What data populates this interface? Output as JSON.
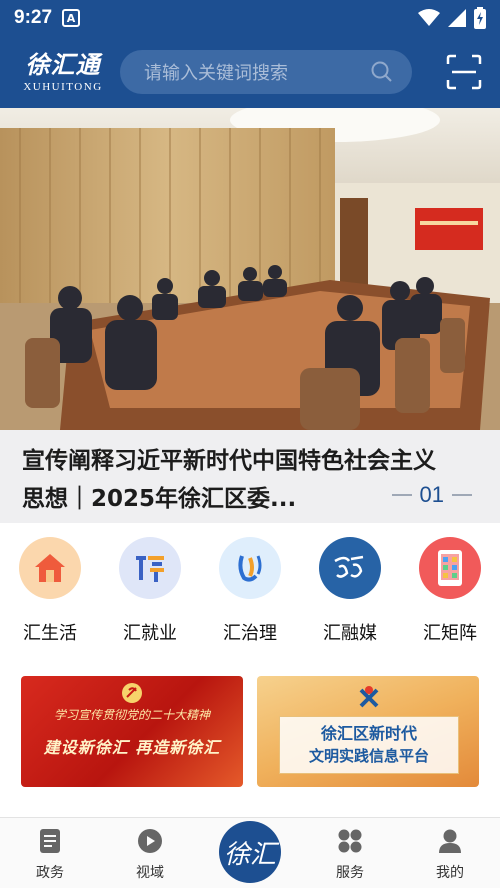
{
  "status": {
    "time": "9:27",
    "notification_letter": "A"
  },
  "header": {
    "brand_cn": "徐汇通",
    "brand_en": "XUHUITONG",
    "search_placeholder": "请输入关键词搜索",
    "icons": {
      "search": "search-icon",
      "scan": "scan-icon"
    }
  },
  "hero": {
    "title_line1": "宣传阐释习近平新时代中国特色社会主义",
    "title_line2": "思想｜2025年徐汇区委...",
    "index": "01"
  },
  "quick_links": [
    {
      "label": "汇生活",
      "icon": "house-icon",
      "bg": "#fbd7ad"
    },
    {
      "label": "汇就业",
      "icon": "job-icon",
      "bg": "#dfe6f8"
    },
    {
      "label": "汇治理",
      "icon": "governance-icon",
      "bg": "#dfeefc"
    },
    {
      "label": "汇融媒",
      "icon": "media-icon",
      "bg": "#2763a6"
    },
    {
      "label": "汇矩阵",
      "icon": "phone-matrix-icon",
      "bg": "#f15a5a"
    }
  ],
  "banners": {
    "left_line1": "学习宣传贯彻党的二十大精神",
    "left_line2": "建设新徐汇  再造新徐汇",
    "right_line1": "徐汇区新时代",
    "right_line2": "文明实践信息平台"
  },
  "nav": {
    "items": [
      {
        "label": "政务",
        "icon": "document-icon"
      },
      {
        "label": "视域",
        "icon": "play-icon"
      },
      {
        "label": "服务",
        "icon": "grid-icon"
      },
      {
        "label": "我的",
        "icon": "user-icon"
      }
    ],
    "center_text": "徐汇",
    "active_color": "#1d4f91"
  },
  "colors": {
    "brand": "#1d4f91",
    "search_bg": "#3d6aa5"
  }
}
